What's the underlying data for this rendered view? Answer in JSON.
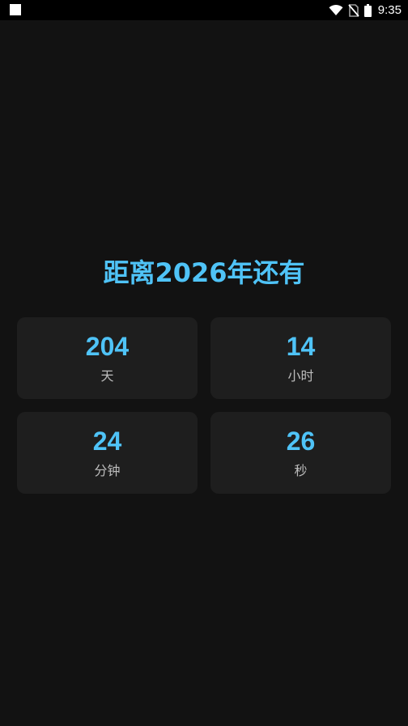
{
  "status_bar": {
    "time": "9:35",
    "icons": [
      "app-notification-icon",
      "wifi-icon",
      "no-sim-icon",
      "battery-icon"
    ]
  },
  "main": {
    "title": "距离2026年还有"
  },
  "countdown": [
    {
      "value": "204",
      "unit": "天"
    },
    {
      "value": "14",
      "unit": "小时"
    },
    {
      "value": "24",
      "unit": "分钟"
    },
    {
      "value": "26",
      "unit": "秒"
    }
  ],
  "colors": {
    "background": "#121212",
    "card": "#1e1e1e",
    "accent": "#4fc3f7",
    "label": "#bdbdbd"
  }
}
